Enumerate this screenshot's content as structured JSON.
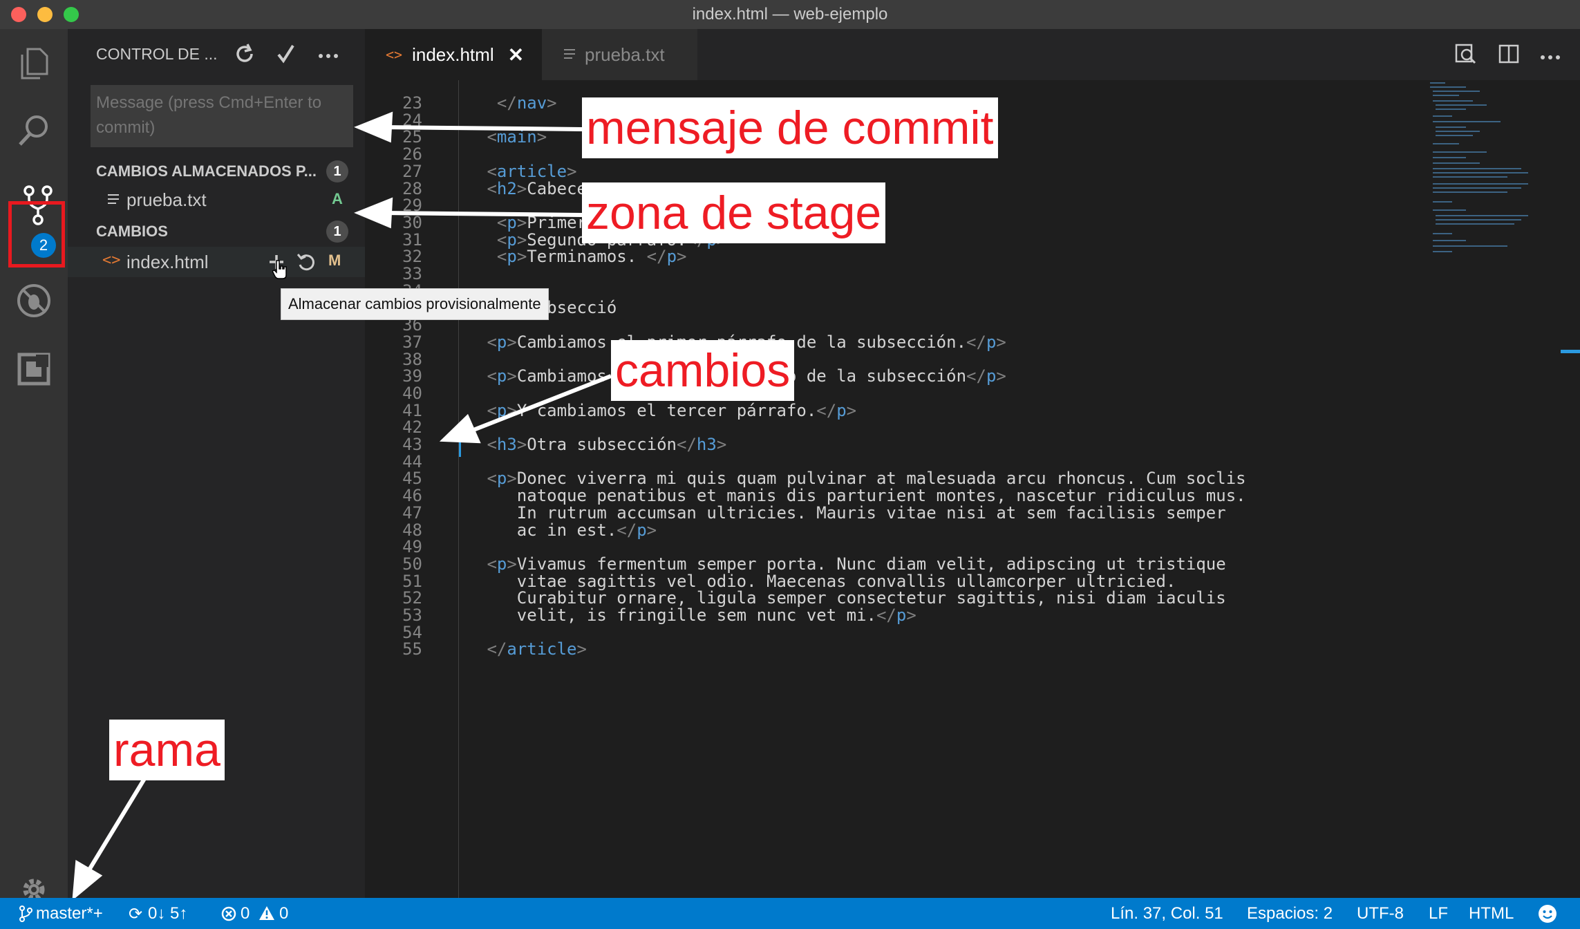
{
  "window": {
    "title": "index.html — web-ejemplo",
    "traffic_lights": [
      "#fc605c",
      "#fdbc40",
      "#34c84a"
    ]
  },
  "activity_bar": {
    "items": [
      "explorer-icon",
      "search-icon",
      "source-control-icon",
      "debug-icon",
      "extensions-icon"
    ],
    "source_control_badge": "2",
    "settings": "gear-icon"
  },
  "sidebar": {
    "title": "CONTROL DE ...",
    "commit_placeholder": "Message (press Cmd+Enter to commit)",
    "staged_header": "CAMBIOS ALMACENADOS P...",
    "staged_count": "1",
    "staged_files": [
      {
        "name": "prueba.txt",
        "status": "A"
      }
    ],
    "changes_header": "CAMBIOS",
    "changes_count": "1",
    "changed_files": [
      {
        "name": "index.html",
        "status": "M"
      }
    ],
    "tooltip": "Almacenar cambios provisionalmente"
  },
  "tabs": [
    {
      "label": "index.html",
      "active": true
    },
    {
      "label": "prueba.txt",
      "active": false
    }
  ],
  "editor": {
    "lines": [
      {
        "n": "23",
        "t": "  </nav>"
      },
      {
        "n": "24",
        "t": ""
      },
      {
        "n": "25",
        "t": " <main>"
      },
      {
        "n": "26",
        "t": ""
      },
      {
        "n": "27",
        "t": " <article>"
      },
      {
        "n": "28",
        "t": " <h2>Cabecer"
      },
      {
        "n": "29",
        "t": ""
      },
      {
        "n": "30",
        "t": "  <p>Primer párrafo.</p>"
      },
      {
        "n": "31",
        "t": "  <p>Segundo párrafo.</p>"
      },
      {
        "n": "32",
        "t": "  <p>Terminamos. </p>"
      },
      {
        "n": "33",
        "t": ""
      },
      {
        "n": "34",
        "t": ""
      },
      {
        "n": "35",
        "t": " <h3>Subsecció"
      },
      {
        "n": "36",
        "t": ""
      },
      {
        "n": "37",
        "t": " <p>Cambiamos el primer párrafo de la subsección.</p>"
      },
      {
        "n": "38",
        "t": ""
      },
      {
        "n": "39",
        "t": " <p>Cambiamos el segundo párrafo de la subsección</p>"
      },
      {
        "n": "40",
        "t": ""
      },
      {
        "n": "41",
        "t": " <p>Y cambiamos el tercer párrafo.</p>"
      },
      {
        "n": "42",
        "t": ""
      },
      {
        "n": "43",
        "t": " <h3>Otra subsección</h3>"
      },
      {
        "n": "44",
        "t": ""
      },
      {
        "n": "45",
        "t": " <p>Donec viverra mi quis quam pulvinar at malesuada arcu rhoncus. Cum soclis"
      },
      {
        "n": "46",
        "t": "    natoque penatibus et manis dis parturient montes, nascetur ridiculus mus."
      },
      {
        "n": "47",
        "t": "    In rutrum accumsan ultricies. Mauris vitae nisi at sem facilisis semper"
      },
      {
        "n": "48",
        "t": "    ac in est.</p>"
      },
      {
        "n": "49",
        "t": ""
      },
      {
        "n": "50",
        "t": " <p>Vivamus fermentum semper porta. Nunc diam velit, adipscing ut tristique"
      },
      {
        "n": "51",
        "t": "    vitae sagittis vel odio. Maecenas convallis ullamcorper ultricied."
      },
      {
        "n": "52",
        "t": "    Curabitur ornare, ligula semper consectetur sagittis, nisi diam iaculis"
      },
      {
        "n": "53",
        "t": "    velit, is fringille sem nunc vet mi.</p>"
      },
      {
        "n": "54",
        "t": ""
      },
      {
        "n": "55",
        "t": " </article>"
      }
    ]
  },
  "annotations": {
    "commit": "mensaje de commit",
    "stage": "zona de stage",
    "changes": "cambios",
    "branch": "rama"
  },
  "statusbar": {
    "branch": "master*+",
    "sync": "0↓ 5↑",
    "errors": "0",
    "warnings": "0",
    "position": "Lín. 37, Col. 51",
    "spaces": "Espacios: 2",
    "encoding": "UTF-8",
    "eol": "LF",
    "language": "HTML"
  },
  "colors": {
    "accent": "#007acc",
    "annotation_text": "#ee1c24",
    "added": "#73c991",
    "modified": "#e2c08d"
  }
}
